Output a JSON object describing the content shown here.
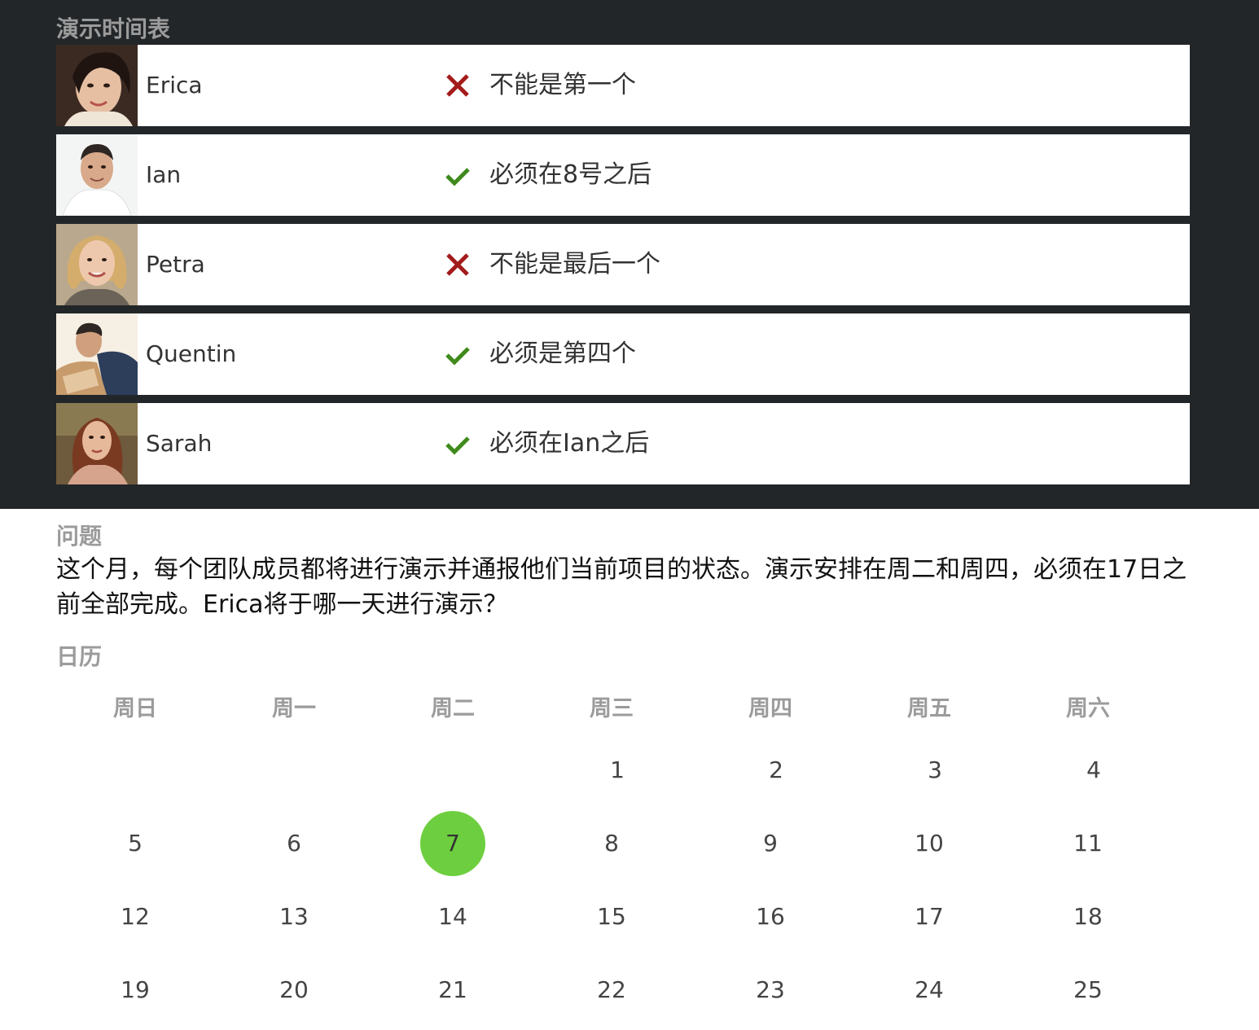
{
  "schedule": {
    "heading": "演示时间表",
    "people": [
      {
        "name": "Erica",
        "status": "cross",
        "rule": "不能是第一个",
        "photo": "erica-photo"
      },
      {
        "name": "Ian",
        "status": "check",
        "rule": "必须在8号之后",
        "photo": "ian-photo"
      },
      {
        "name": "Petra",
        "status": "cross",
        "rule": "不能是最后一个",
        "photo": "petra-photo"
      },
      {
        "name": "Quentin",
        "status": "check",
        "rule": "必须是第四个",
        "photo": "quentin-photo"
      },
      {
        "name": "Sarah",
        "status": "check",
        "rule": "必须在Ian之后",
        "photo": "sarah-photo"
      }
    ],
    "colors": {
      "cross": "#a31b1b",
      "check": "#3f8a1c",
      "panel": "#222629"
    }
  },
  "question": {
    "heading": "问题",
    "text": "这个月，每个团队成员都将进行演示并通报他们当前项目的状态。演示安排在周二和周四，必须在17日之前全部完成。Erica将于哪一天进行演示？"
  },
  "calendar": {
    "heading": "日历",
    "weekdays": [
      "周日",
      "周一",
      "周二",
      "周三",
      "周四",
      "周五",
      "周六"
    ],
    "weeks": [
      [
        "",
        "",
        "",
        "1",
        "2",
        "3",
        "4"
      ],
      [
        "5",
        "6",
        "7",
        "8",
        "9",
        "10",
        "11"
      ],
      [
        "12",
        "13",
        "14",
        "15",
        "16",
        "17",
        "18"
      ],
      [
        "19",
        "20",
        "21",
        "22",
        "23",
        "24",
        "25"
      ]
    ],
    "selected_day": "7",
    "selected_color": "#6dcf3f"
  }
}
